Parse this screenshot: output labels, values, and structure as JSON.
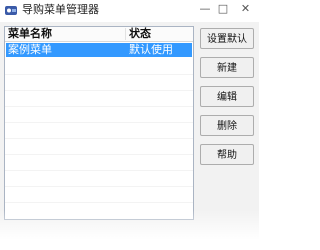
{
  "window": {
    "title": "导购菜单管理器",
    "icon": "app-icon",
    "controls": {
      "minimize": "—",
      "maximize": "□",
      "close": "✕"
    }
  },
  "list": {
    "columns": [
      "菜单名称",
      "状态"
    ],
    "rows": [
      {
        "name": "案例菜单",
        "state": "默认使用",
        "selected": true
      }
    ]
  },
  "buttons": {
    "set_default": "设置默认",
    "new": "新建",
    "edit": "编辑",
    "delete": "删除",
    "help": "帮助"
  },
  "colors": {
    "selection": "#3399ff",
    "background": "#f0f0f0"
  }
}
